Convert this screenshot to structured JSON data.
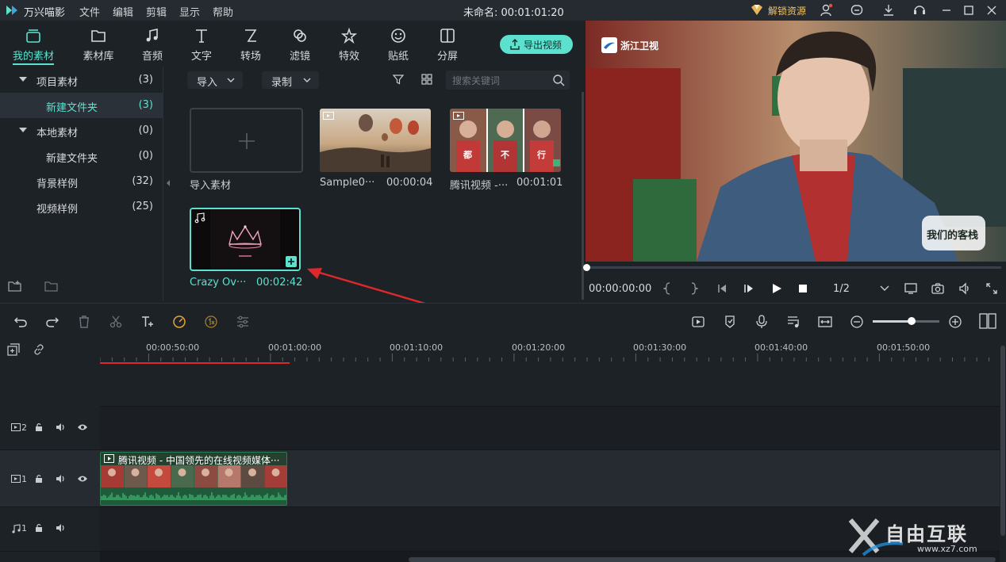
{
  "app": {
    "name": "万兴喵影",
    "menu": [
      "文件",
      "编辑",
      "剪辑",
      "显示",
      "帮助"
    ],
    "doc_title": "未命名: 00:01:01:20",
    "unlock_label": "解锁资源"
  },
  "toolbar": {
    "tabs": [
      {
        "label": "我的素材",
        "icon": "folder-stack-icon",
        "active": true
      },
      {
        "label": "素材库",
        "icon": "folder-icon"
      },
      {
        "label": "音频",
        "icon": "music-note-icon"
      },
      {
        "label": "文字",
        "icon": "text-icon"
      },
      {
        "label": "转场",
        "icon": "transition-icon"
      },
      {
        "label": "滤镜",
        "icon": "filter-icon"
      },
      {
        "label": "特效",
        "icon": "effects-icon"
      },
      {
        "label": "贴纸",
        "icon": "sticker-icon"
      },
      {
        "label": "分屏",
        "icon": "split-screen-icon"
      }
    ],
    "export_label": "导出视频",
    "accent": "#5ce1cf"
  },
  "sidebar": {
    "items": [
      {
        "label": "项目素材",
        "count": "(3)"
      },
      {
        "label": "新建文件夹",
        "count": "(3)"
      },
      {
        "label": "本地素材",
        "count": "(0)"
      },
      {
        "label": "新建文件夹",
        "count": "(0)"
      },
      {
        "label": "背景样例",
        "count": "(32)"
      },
      {
        "label": "视频样例",
        "count": "(25)"
      }
    ]
  },
  "media": {
    "import_dropdown": "导入",
    "record_dropdown": "录制",
    "search_placeholder": "搜索关键词",
    "items": [
      {
        "name": "导入素材",
        "duration": ""
      },
      {
        "name": "Sample0···",
        "duration": "00:00:04"
      },
      {
        "name": "腾讯视频 -···",
        "duration": "00:01:01"
      },
      {
        "name": "Crazy Ov···",
        "duration": "00:02:42"
      }
    ],
    "tencent_captions": [
      "都",
      "不",
      "行"
    ]
  },
  "preview": {
    "channel_logo": "浙江卫视",
    "show_logo": "我们的客栈",
    "timecode": "00:00:00:00",
    "page": "1/2"
  },
  "timeline": {
    "ruler": [
      "00:00:50:00",
      "00:01:00:00",
      "00:01:10:00",
      "00:01:20:00",
      "00:01:30:00",
      "00:01:40:00",
      "00:01:50:00"
    ],
    "tracks": [
      {
        "label": "2",
        "type": "video"
      },
      {
        "label": "1",
        "type": "video"
      },
      {
        "label": "1",
        "type": "audio"
      }
    ],
    "clip_title": "腾讯视频 - 中国领先的在线视频媒体···"
  },
  "watermark": {
    "text": "自由互联",
    "url": "www.xz7.com"
  }
}
